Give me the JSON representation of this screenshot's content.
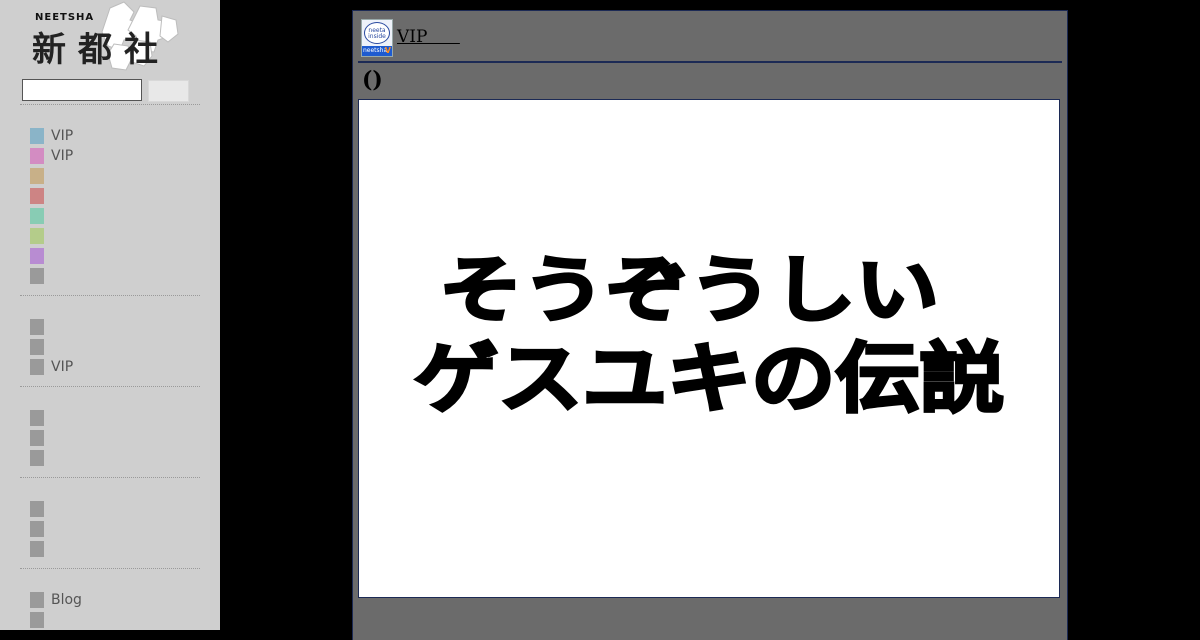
{
  "sidebar": {
    "logo": {
      "small_text": "NEETSHA",
      "kanji": "新都社"
    },
    "search": {
      "value": "",
      "button_label": ""
    },
    "groups": [
      {
        "items": [
          {
            "label": "VIP",
            "color": "#8ab4c8"
          },
          {
            "label": "VIP",
            "color": "#d38cc2"
          },
          {
            "label": "",
            "color": "#c8b088"
          },
          {
            "label": "",
            "color": "#cd8484"
          },
          {
            "label": "",
            "color": "#88ccb4"
          },
          {
            "label": "",
            "color": "#b4cc8a"
          },
          {
            "label": "",
            "color": "#b88cd2"
          },
          {
            "label": "",
            "color": "#9a9a9a"
          }
        ]
      },
      {
        "items": [
          {
            "label": "",
            "color": "#9a9a9a"
          },
          {
            "label": "",
            "color": "#9a9a9a"
          },
          {
            "label": "VIP",
            "color": "#9a9a9a"
          }
        ]
      },
      {
        "items": [
          {
            "label": "",
            "color": "#9a9a9a"
          },
          {
            "label": "",
            "color": "#9a9a9a"
          },
          {
            "label": "",
            "color": "#9a9a9a"
          }
        ]
      },
      {
        "items": [
          {
            "label": "",
            "color": "#9a9a9a"
          },
          {
            "label": "",
            "color": "#9a9a9a"
          },
          {
            "label": "",
            "color": "#9a9a9a"
          }
        ]
      },
      {
        "items": [
          {
            "label": "Blog",
            "color": "#9a9a9a"
          },
          {
            "label": "",
            "color": "#9a9a9a"
          }
        ]
      }
    ]
  },
  "main": {
    "badge": {
      "top_text": "neeta inside",
      "strip_text": "neetsha",
      "mark": "V"
    },
    "top_link": "VIP      ",
    "title": "()",
    "image": {
      "line1": "そうぞうしい",
      "line2": "ゲスユキの伝説"
    }
  },
  "colors": {
    "sidebar_bg": "#cfcfcf",
    "panel_bg": "#6b6b6b",
    "panel_border": "#1c2a55",
    "page_bg": "#000000"
  }
}
